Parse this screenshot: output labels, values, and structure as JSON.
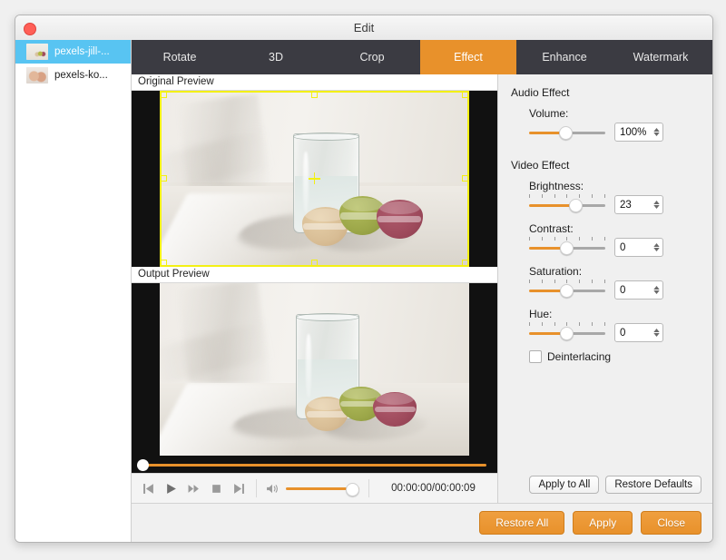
{
  "window": {
    "title": "Edit",
    "close_label": "Close window"
  },
  "sidebar": {
    "files": [
      {
        "name": "pexels-jill-...",
        "selected": true
      },
      {
        "name": "pexels-ko...",
        "selected": false
      }
    ]
  },
  "tabs": [
    {
      "label": "Rotate",
      "active": false
    },
    {
      "label": "3D",
      "active": false
    },
    {
      "label": "Crop",
      "active": false
    },
    {
      "label": "Effect",
      "active": true
    },
    {
      "label": "Enhance",
      "active": false
    },
    {
      "label": "Watermark",
      "active": false
    }
  ],
  "previews": {
    "original_label": "Original Preview",
    "output_label": "Output Preview"
  },
  "transport": {
    "buttons": [
      "previous-icon",
      "play-icon",
      "fast-forward-icon",
      "stop-icon",
      "next-icon"
    ],
    "volume_icon": "speaker-icon",
    "time": "00:00:00/00:00:09"
  },
  "panel": {
    "audio_group": "Audio Effect",
    "video_group": "Video Effect",
    "controls": [
      {
        "label": "Volume:",
        "value": "100%",
        "fill": 45,
        "ticks": false
      },
      {
        "label": "Brightness:",
        "value": "23",
        "fill": 58,
        "ticks": true
      },
      {
        "label": "Contrast:",
        "value": "0",
        "fill": 47,
        "ticks": true
      },
      {
        "label": "Saturation:",
        "value": "0",
        "fill": 47,
        "ticks": true
      },
      {
        "label": "Hue:",
        "value": "0",
        "fill": 47,
        "ticks": true
      }
    ],
    "deinterlacing": {
      "label": "Deinterlacing",
      "checked": false
    },
    "apply_to_all": "Apply to All",
    "restore_defaults": "Restore Defaults"
  },
  "footer": {
    "restore_all": "Restore All",
    "apply": "Apply",
    "close": "Close"
  },
  "colors": {
    "accent": "#e8912b",
    "tab_bar": "#3b3b42",
    "selection": "#58c4f2",
    "crop_outline": "#f3f014",
    "macaron_tan": "#d8bd95",
    "macaron_green": "#9ba648",
    "macaron_maroon": "#9e4a5c"
  }
}
